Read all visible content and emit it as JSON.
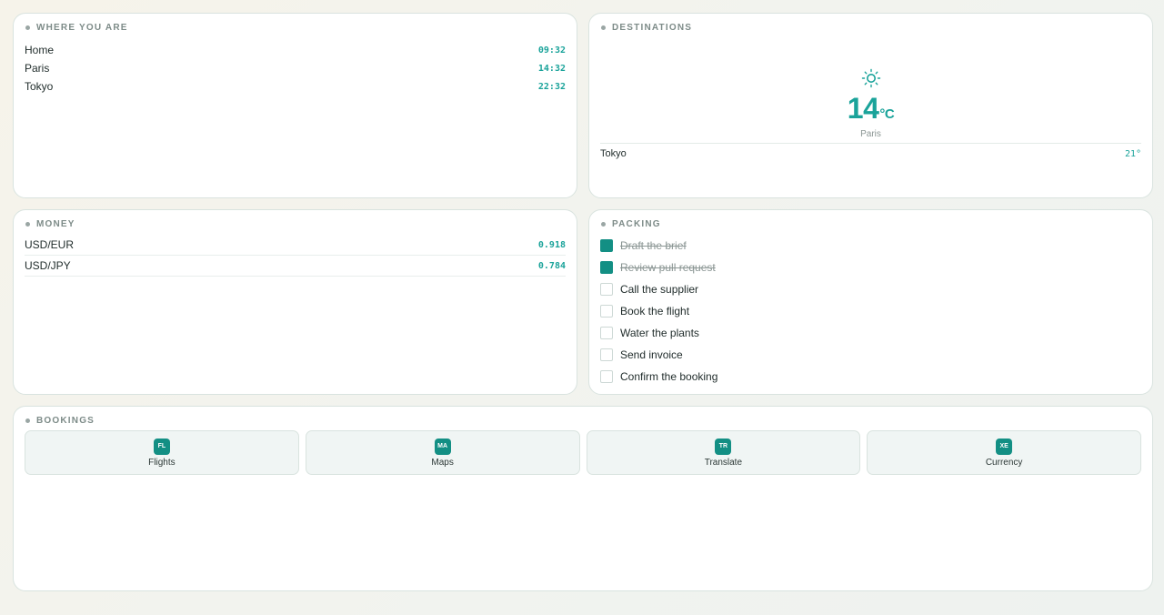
{
  "world": {
    "title": "WHERE YOU ARE",
    "rows": [
      {
        "city": "Home",
        "time": "09:32"
      },
      {
        "city": "Paris",
        "time": "14:32"
      },
      {
        "city": "Tokyo",
        "time": "22:32"
      }
    ]
  },
  "weather": {
    "title": "DESTINATIONS",
    "icon": "sun-icon",
    "temp": "14",
    "unit": "°C",
    "city": "Paris",
    "other": {
      "city": "Tokyo",
      "temp": "21°"
    }
  },
  "money": {
    "title": "MONEY",
    "rows": [
      {
        "pair": "USD/EUR",
        "rate": "0.918"
      },
      {
        "pair": "USD/JPY",
        "rate": "0.784"
      }
    ]
  },
  "packing": {
    "title": "PACKING",
    "items": [
      {
        "text": "Draft the brief",
        "done": true
      },
      {
        "text": "Review pull request",
        "done": true
      },
      {
        "text": "Call the supplier",
        "done": false
      },
      {
        "text": "Book the flight",
        "done": false
      },
      {
        "text": "Water the plants",
        "done": false
      },
      {
        "text": "Send invoice",
        "done": false
      },
      {
        "text": "Confirm the booking",
        "done": false
      }
    ]
  },
  "bookings": {
    "title": "BOOKINGS",
    "tiles": [
      {
        "badge": "FL",
        "label": "Flights"
      },
      {
        "badge": "MA",
        "label": "Maps"
      },
      {
        "badge": "TR",
        "label": "Translate"
      },
      {
        "badge": "XE",
        "label": "Currency"
      }
    ]
  },
  "colors": {
    "accent": "#1aa39a",
    "accent_dark": "#138f84"
  }
}
